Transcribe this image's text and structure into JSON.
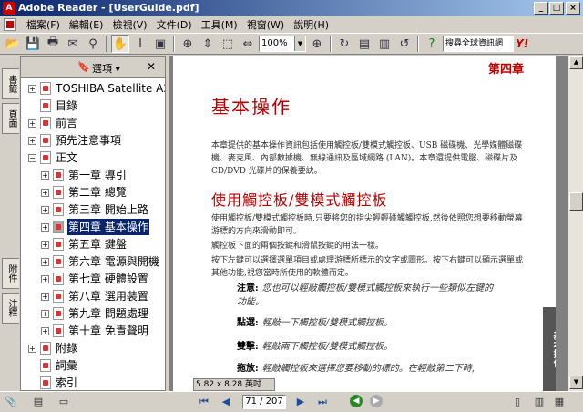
{
  "window": {
    "title": "Adobe Reader - [UserGuide.pdf]"
  },
  "menu": [
    "檔案(F)",
    "編輯(E)",
    "檢視(V)",
    "文件(D)",
    "工具(M)",
    "視窗(W)",
    "說明(H)"
  ],
  "toolbar": {
    "zoom_value": "100%",
    "search_placeholder": "搜尋全球資訊網",
    "yahoo": "Y!"
  },
  "tabs": [
    "書籤",
    "頁面",
    "附件",
    "注釋"
  ],
  "nav": {
    "options_label": "選項 ▾",
    "close": "✕"
  },
  "bookmarks": [
    {
      "label": "TOSHIBA Satellite A200",
      "level": 0,
      "expand": "+"
    },
    {
      "label": "目錄",
      "level": 0,
      "expand": ""
    },
    {
      "label": "前言",
      "level": 0,
      "expand": "+"
    },
    {
      "label": "預先注意事項",
      "level": 0,
      "expand": "+"
    },
    {
      "label": "正文",
      "level": 0,
      "expand": "−"
    },
    {
      "label": "第一章 導引",
      "level": 1,
      "expand": "+"
    },
    {
      "label": "第二章 總覽",
      "level": 1,
      "expand": "+"
    },
    {
      "label": "第三章 開始上路",
      "level": 1,
      "expand": "+"
    },
    {
      "label": "第四章 基本操作",
      "level": 1,
      "expand": "+",
      "selected": true
    },
    {
      "label": "第五章 鍵盤",
      "level": 1,
      "expand": "+"
    },
    {
      "label": "第六章 電源與開機",
      "level": 1,
      "expand": "+"
    },
    {
      "label": "第七章 硬體設置",
      "level": 1,
      "expand": "+"
    },
    {
      "label": "第八章 選用裝置",
      "level": 1,
      "expand": "+"
    },
    {
      "label": "第九章 問題處理",
      "level": 1,
      "expand": "+"
    },
    {
      "label": "第十章 免責聲明",
      "level": 1,
      "expand": "+"
    },
    {
      "label": "附錄",
      "level": 0,
      "expand": "+"
    },
    {
      "label": "詞彙",
      "level": 0,
      "expand": ""
    },
    {
      "label": "索引",
      "level": 0,
      "expand": ""
    }
  ],
  "page": {
    "chapter": "第四章",
    "title": "基本操作",
    "intro": "本章提供的基本操作資訊包括使用觸控板/雙模式觸控板、USB 磁碟機、光學媒體磁碟機、麥克風、內部數據機、無線通訊及區域網路 (LAN)。本章還提供電腦、磁碟片及 CD/DVD 光碟片的保養要訣。",
    "section_title": "使用觸控板/雙模式觸控板",
    "para1": "使用觸控板/雙模式觸控板時,只要將您的指尖輕輕碰觸觸控板,然後依照您想要移動螢幕游標的方向來滑動即可。",
    "para2": "觸控板下面的兩個按鍵和滑鼠按鍵的用法一樣。",
    "para3": "按下左鍵可以選擇選單項目或處理游標所標示的文字或圖形。按下右鍵可以顯示選單或其他功能,視您當時所使用的軟體而定。",
    "notes": [
      {
        "term": "注意:",
        "text": "您也可以輕敲觸控板/雙模式觸控板來執行一些類似左鍵的功能。"
      },
      {
        "term": "點選:",
        "text": "輕敲一下觸控板/雙模式觸控板。"
      },
      {
        "term": "雙擊:",
        "text": "輕敲兩下觸控板/雙模式觸控板。"
      },
      {
        "term": "拖放:",
        "text": "輕敲觸控板來選擇您要移動的標的。在輕敲第二下時,"
      }
    ],
    "side_tab": "基本操作"
  },
  "status": {
    "page_size": "5.82 x 8.28 英吋",
    "page_indicator": "71 / 207"
  }
}
